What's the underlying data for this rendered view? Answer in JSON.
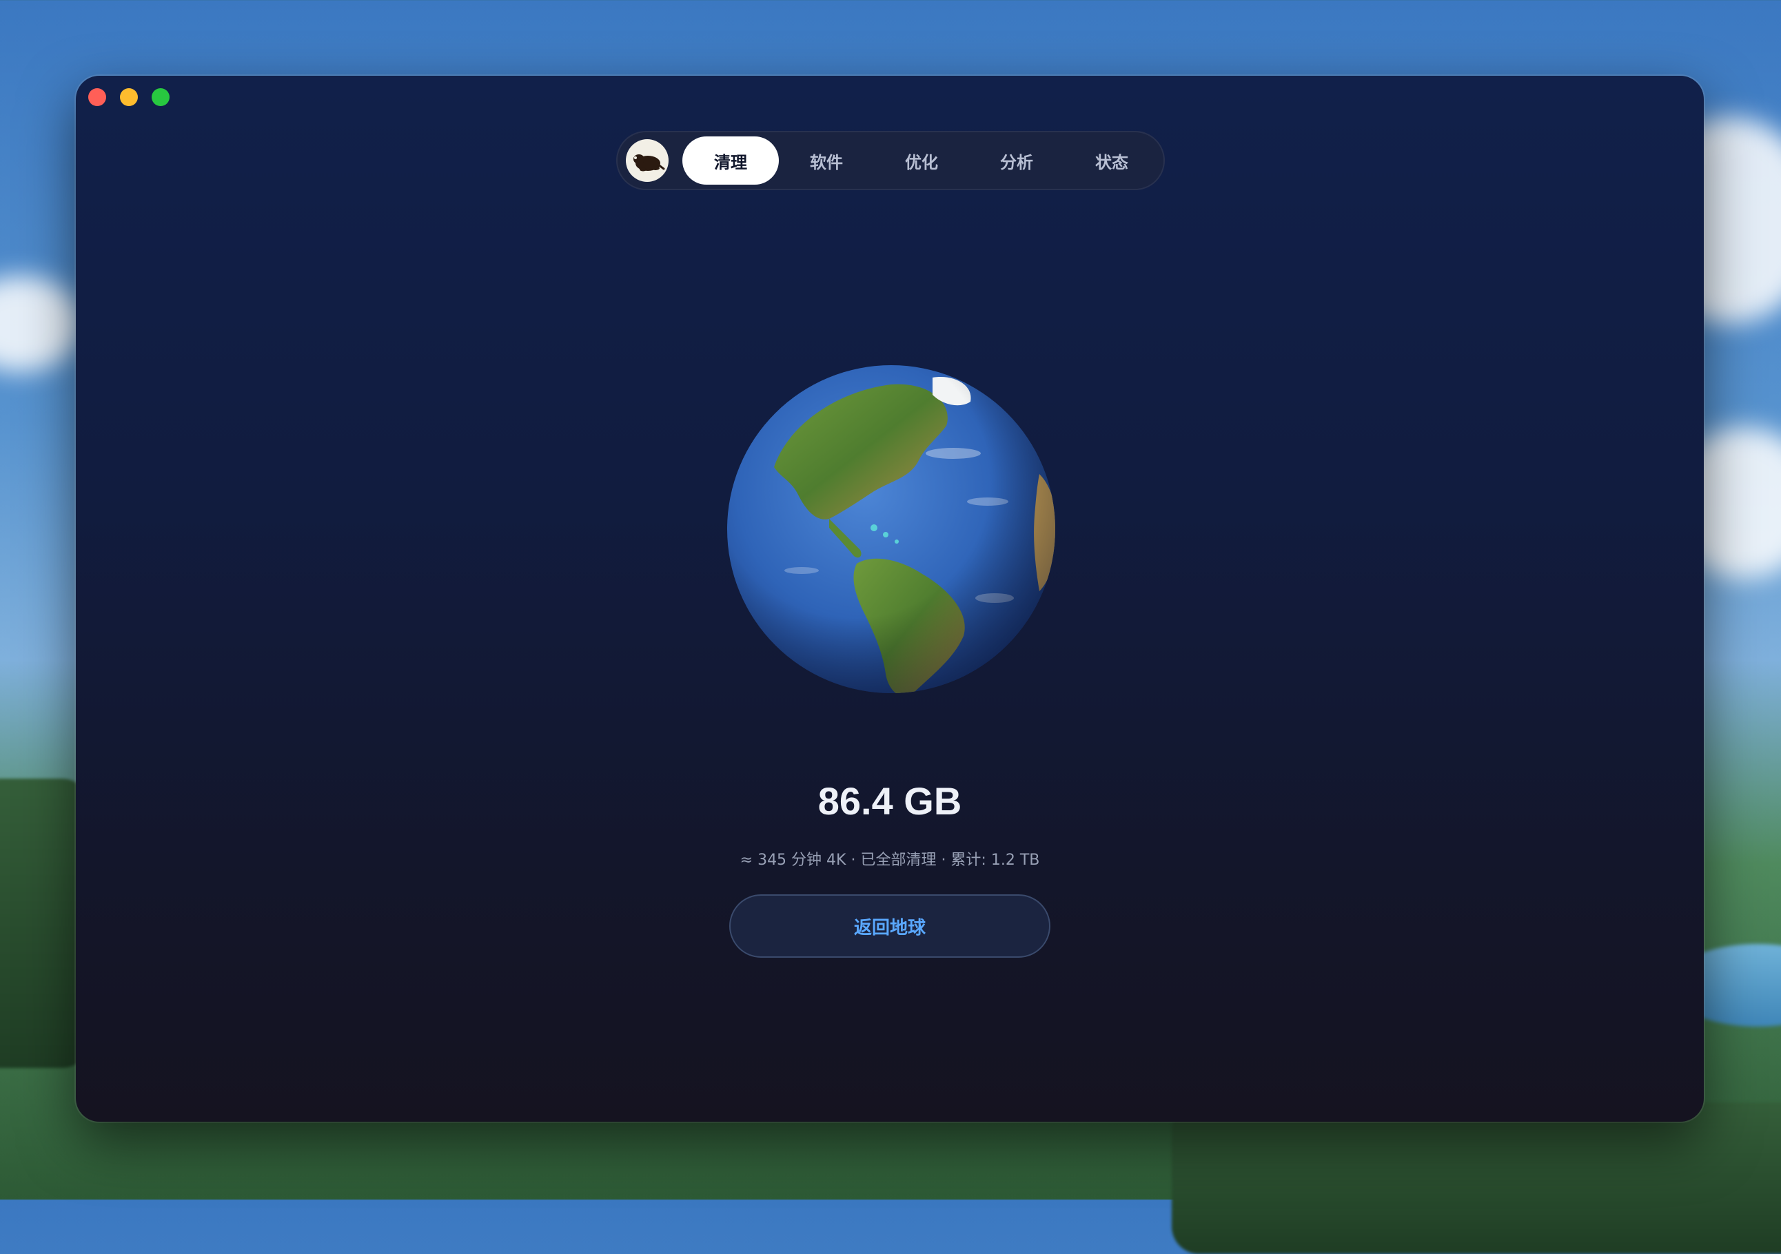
{
  "window": {
    "traffic_lights": [
      "close",
      "minimize",
      "zoom"
    ]
  },
  "tabs": [
    {
      "label": "清理",
      "active": true
    },
    {
      "label": "软件",
      "active": false
    },
    {
      "label": "优化",
      "active": false
    },
    {
      "label": "分析",
      "active": false
    },
    {
      "label": "状态",
      "active": false
    }
  ],
  "result": {
    "amount": "86.4 GB",
    "details": "≈ 345 分钟 4K · 已全部清理 · 累计: 1.2 TB",
    "back_button": "返回地球"
  },
  "colors": {
    "accent": "#5aa8ff",
    "active_tab_bg": "#ffffff",
    "window_top": "#11204a",
    "window_bottom": "#151320"
  },
  "icons": {
    "avatar": "mole-logo-icon",
    "hero": "earth-globe-icon"
  }
}
